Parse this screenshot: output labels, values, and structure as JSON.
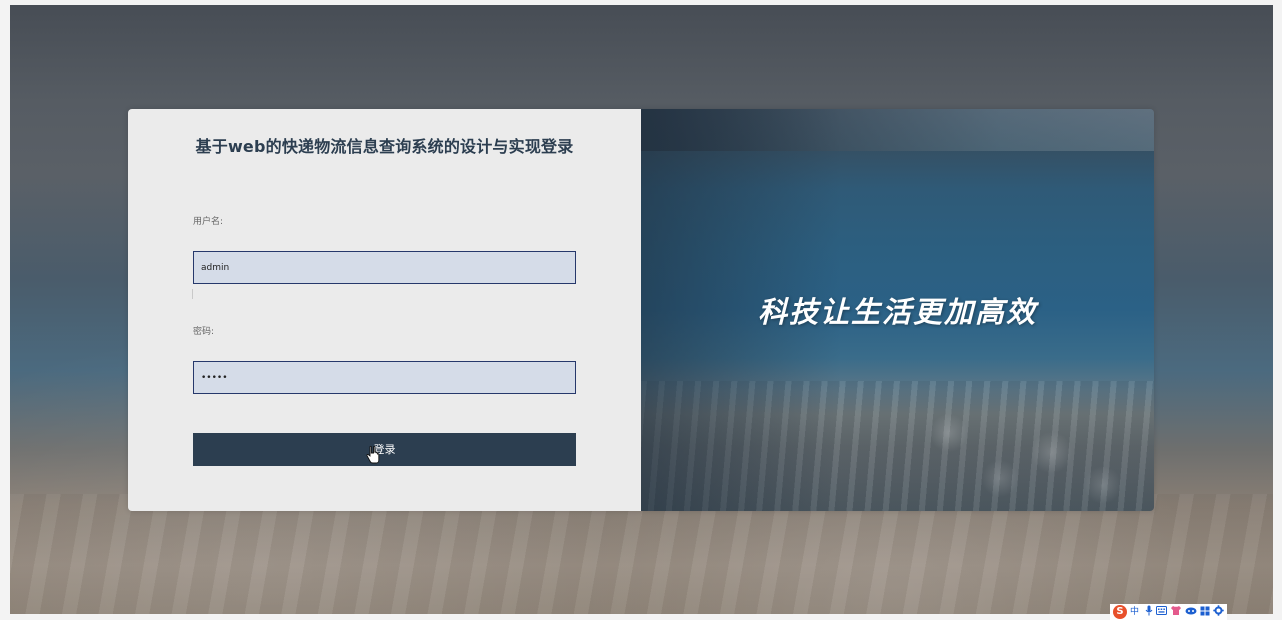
{
  "login": {
    "title": "基于web的快递物流信息查询系统的设计与实现登录",
    "username_label": "用户名:",
    "username_value": "admin",
    "password_label": "密码:",
    "password_value": "admin",
    "submit_label": "登录"
  },
  "banner": {
    "slogan": "科技让生活更加高效"
  },
  "ime_toolbar": {
    "logo": "S",
    "mode": "中",
    "items": [
      "·,",
      "mic-icon",
      "keyboard-icon",
      "shirt-icon",
      "cloud-icon",
      "grid-icon",
      "gear-icon"
    ]
  },
  "colors": {
    "primary": "#2c3e50",
    "input_bg": "#d5dce8",
    "input_border": "#26386b",
    "form_panel_bg": "#ebebeb"
  }
}
